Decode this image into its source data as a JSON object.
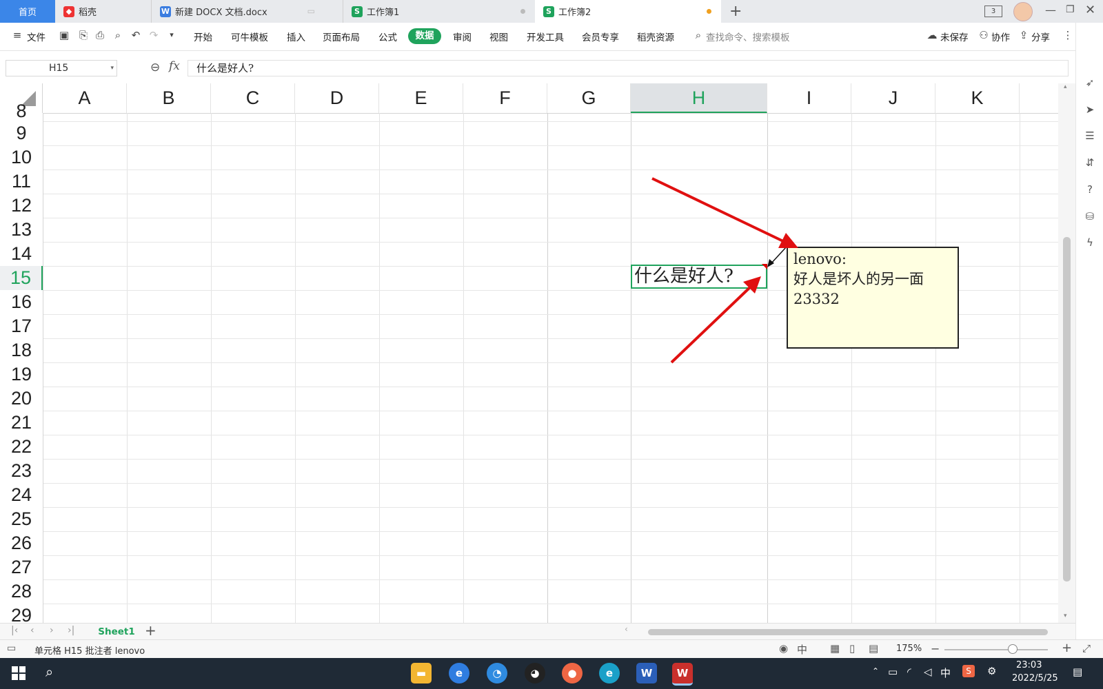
{
  "tabs": {
    "home": "首页",
    "daoke": "稻壳",
    "docx": "新建 DOCX 文档.docx",
    "book1": "工作簿1",
    "book2": "工作簿2"
  },
  "ribbon": {
    "file": "文件",
    "menu": [
      "开始",
      "可牛模板",
      "插入",
      "页面布局",
      "公式",
      "数据",
      "审阅",
      "视图",
      "开发工具",
      "会员专享",
      "稻壳资源"
    ],
    "search_placeholder": "查找命令、搜索模板",
    "unsaved": "未保存",
    "collab": "协作",
    "share": "分享"
  },
  "formula_bar": {
    "name_box": "H15",
    "fx": "fx",
    "content": "什么是好人?"
  },
  "grid": {
    "columns": [
      "A",
      "B",
      "C",
      "D",
      "E",
      "F",
      "G",
      "H",
      "I",
      "J",
      "K"
    ],
    "selected_column": "H",
    "rows": [
      "8",
      "9",
      "10",
      "11",
      "12",
      "13",
      "14",
      "15",
      "16",
      "17",
      "18",
      "19",
      "20",
      "21",
      "22",
      "23",
      "24",
      "25",
      "26",
      "27",
      "28",
      "29"
    ],
    "selected_row": "15",
    "cell_h15": "什么是好人?"
  },
  "comment": {
    "author": "lenovo:",
    "line1": "好人是坏人的另一面",
    "line2": "23332"
  },
  "sheets": [
    "Sheet1"
  ],
  "status": {
    "text": "单元格 H15 批注者 lenovo",
    "zoom": "175%"
  },
  "taskbar": {
    "ime": "中",
    "time": "23:03",
    "date": "2022/5/25"
  },
  "colors": {
    "accent_green": "#1fa35c",
    "home_tab_blue": "#3b86e8",
    "arrow_red": "#e01010",
    "comment_bg": "#ffffe1"
  }
}
